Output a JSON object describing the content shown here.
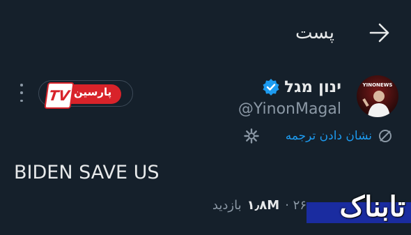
{
  "header": {
    "title": "پست"
  },
  "author": {
    "display_name": "ינון מגל",
    "handle": "@YinonMagal",
    "avatar_label": "YINONEWS"
  },
  "channel_badge": {
    "text": "پارسین",
    "logo": "TV"
  },
  "translate": {
    "label": "نشان دادن ترجمه"
  },
  "tweet": {
    "text": "BIDEN SAVE US"
  },
  "meta": {
    "views_count": "۱٫۸M",
    "views_label": "بازدید",
    "date_fragment": "۲۶ ·"
  },
  "watermark": {
    "text": "تابناک"
  },
  "colors": {
    "background": "#15202b",
    "accent": "#1d9bf0",
    "muted": "#8b98a5",
    "badge_red": "#d8232a"
  }
}
